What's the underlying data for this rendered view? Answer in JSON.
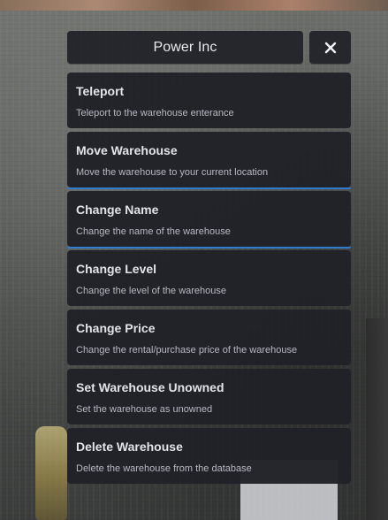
{
  "header": {
    "title": "Power Inc",
    "close_icon": "close-icon"
  },
  "menu": {
    "items": [
      {
        "title": "Teleport",
        "description": "Teleport to the warehouse enterance"
      },
      {
        "title": "Move Warehouse",
        "description": "Move the warehouse to your current location"
      },
      {
        "title": "Change Name",
        "description": "Change the name of the warehouse"
      },
      {
        "title": "Change Level",
        "description": "Change the level of the warehouse"
      },
      {
        "title": "Change Price",
        "description": "Change the rental/purchase price of the warehouse"
      },
      {
        "title": "Set Warehouse Unowned",
        "description": "Set the warehouse as unowned"
      },
      {
        "title": "Delete Warehouse",
        "description": "Delete the warehouse from the database"
      }
    ]
  },
  "colors": {
    "panel_bg": "#212228",
    "title_text": "#e3e3ea",
    "desc_text": "#b8b9c3",
    "accent": "#2f7dd6"
  }
}
